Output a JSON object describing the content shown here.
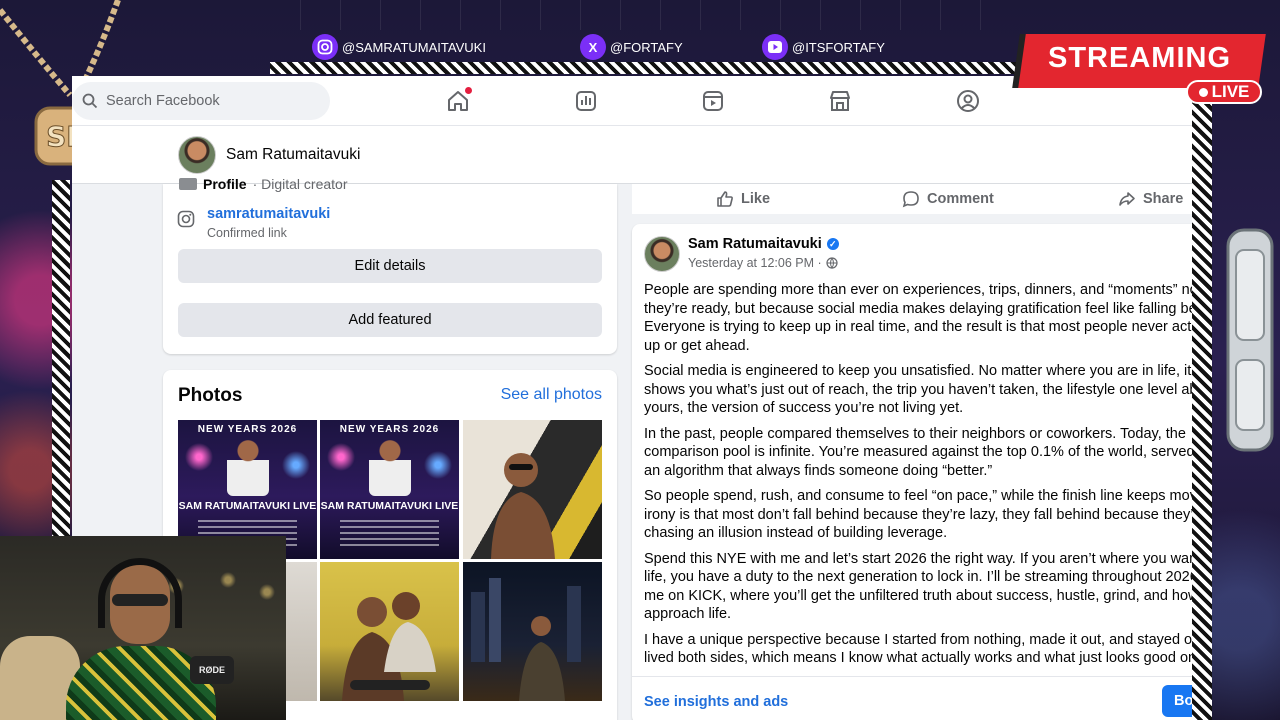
{
  "overlay": {
    "socials": [
      {
        "icon": "instagram-icon",
        "handle": "@SAMRATUMAITAVUKI"
      },
      {
        "icon": "x-icon",
        "handle": "@FORTAFY"
      },
      {
        "icon": "youtube-icon",
        "handle": "@ITSFORTAFY"
      }
    ],
    "streaming_label": "STREAMING",
    "live_label": "LIVE",
    "brand_color": "#e3262f",
    "accent_color": "#7b2ff7"
  },
  "fb": {
    "search_placeholder": "Search Facebook",
    "nav_icons": [
      "home-icon",
      "dashboard-icon",
      "reels-icon",
      "marketplace-icon",
      "profile-icon"
    ],
    "profile_name": "Sam Ratumaitavuki",
    "intro": {
      "partial_label": "Profile",
      "partial_value": "· Digital creator",
      "instagram_handle": "samratumaitavuki",
      "instagram_sub": "Confirmed link",
      "edit_details": "Edit details",
      "add_featured": "Add featured"
    },
    "photos": {
      "title": "Photos",
      "see_all": "See all photos",
      "poster_title": "NEW YEARS 2026",
      "poster_name": "SAM RATUMAITAVUKI LIVE"
    },
    "actions": {
      "like": "Like",
      "comment": "Comment",
      "share": "Share"
    },
    "post": {
      "author": "Sam Ratumaitavuki",
      "time": "Yesterday at 12:06 PM ·",
      "paragraphs": [
        [
          "People are spending more than ever on experiences, trips, dinners, and “moments” not",
          "they’re ready, but because social media makes delaying gratification feel like falling bel",
          "Everyone is trying to keep up in real time, and the result is that most people never actu",
          "up or get ahead."
        ],
        [
          "Social media is engineered to keep you unsatisfied. No matter where you are in life, it c",
          "shows you what’s just out of reach, the trip you haven’t taken, the lifestyle one level ab",
          "yours, the version of success you’re not living yet."
        ],
        [
          "In the past, people compared themselves to their neighbors or coworkers. Today, the",
          "comparison pool is infinite. You’re measured against the top 0.1% of the world, served",
          "an algorithm that always finds someone doing “better.”"
        ],
        [
          "So people spend, rush, and consume to feel “on pace,” while the finish line keeps movi",
          "irony is that most don’t fall behind because they’re lazy, they fall behind because they’",
          "chasing an illusion instead of building leverage."
        ],
        [
          "Spend this NYE with me and let’s start 2026 the right way. If you aren’t where you want",
          "life, you have a duty to the next generation to lock in. I’ll be streaming throughout 2026",
          "me on KICK, where you’ll get the unfiltered truth about success, hustle, grind, and how",
          "approach life."
        ],
        [
          "I have a unique perspective because I started from nothing, made it out, and stayed ou",
          "lived both sides, which means I know what actually works and what just looks good onl"
        ]
      ],
      "insights": "See insights and ads",
      "boost": "Bo"
    },
    "blue": "#216fdb"
  },
  "webcam": {
    "mic_label": "RØDE"
  }
}
